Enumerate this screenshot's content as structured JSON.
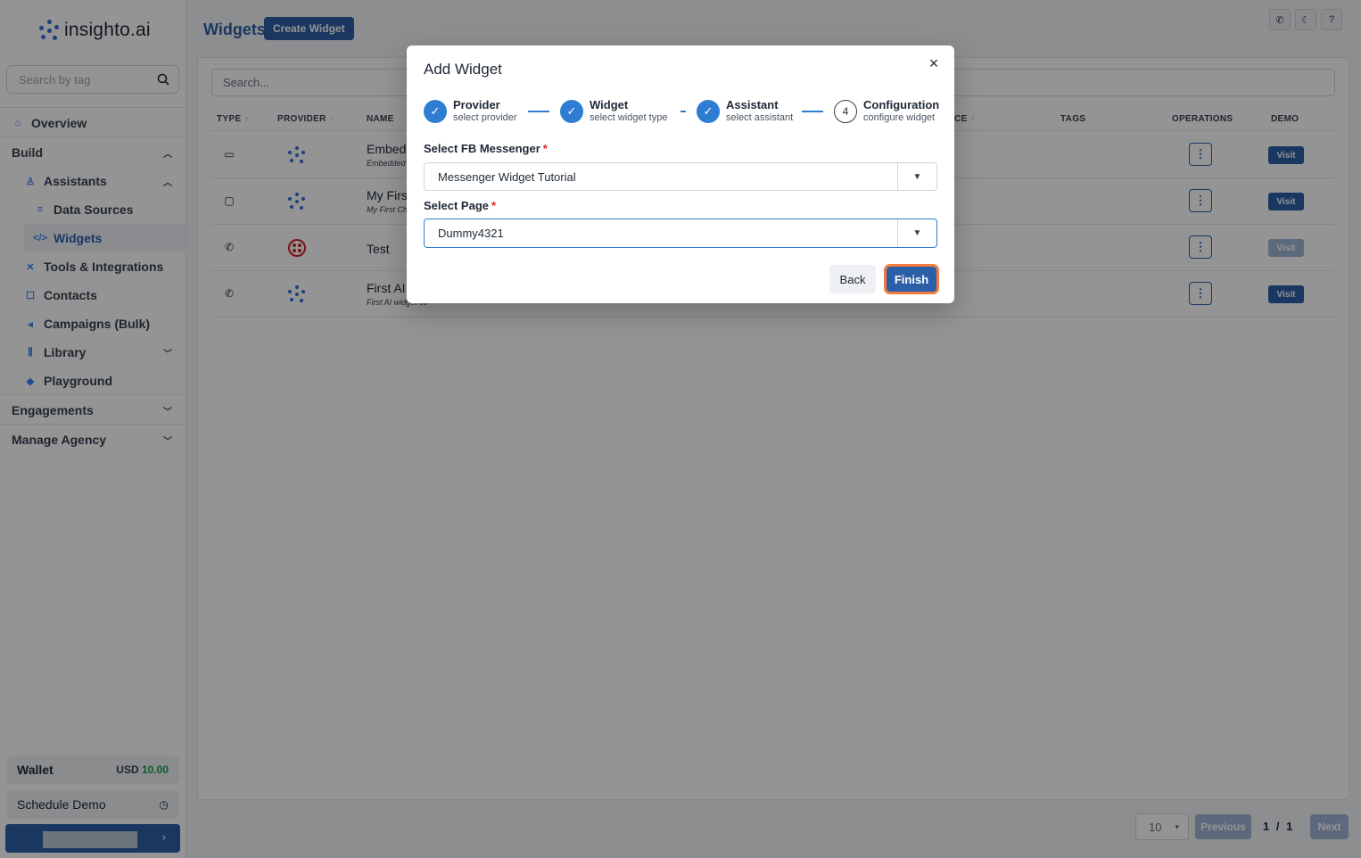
{
  "app": {
    "logo_text": "insighto.ai"
  },
  "sidebar": {
    "search_placeholder": "Search by tag",
    "items": [
      {
        "label": "Overview",
        "icon": "home-icon"
      },
      {
        "label": "Build",
        "icon": "",
        "chevron": "up"
      },
      {
        "label": "Assistants",
        "icon": "user-icon",
        "chevron": "up"
      },
      {
        "label": "Data Sources",
        "icon": "database-icon"
      },
      {
        "label": "Widgets",
        "icon": "code-icon"
      },
      {
        "label": "Tools & Integrations",
        "icon": "tools-icon"
      },
      {
        "label": "Contacts",
        "icon": "contacts-icon"
      },
      {
        "label": "Campaigns (Bulk)",
        "icon": "megaphone-icon"
      },
      {
        "label": "Library",
        "icon": "library-icon",
        "chevron": "down"
      },
      {
        "label": "Playground",
        "icon": "gamepad-icon"
      },
      {
        "label": "Engagements",
        "icon": "",
        "chevron": "down"
      },
      {
        "label": "Manage Agency",
        "icon": "",
        "chevron": "down"
      }
    ],
    "wallet": {
      "label": "Wallet",
      "currency": "USD",
      "amount": "10.00"
    },
    "schedule_demo": "Schedule Demo"
  },
  "header": {
    "title": "Widgets",
    "create_button": "Create Widget"
  },
  "main": {
    "search_placeholder": "Search...",
    "columns": [
      "TYPE",
      "PROVIDER",
      "NAME",
      "CE",
      "TAGS",
      "OPERATIONS",
      "DEMO"
    ],
    "rows": [
      {
        "type_icon": "window-icon",
        "provider": "insighto",
        "name": "Embed",
        "sub": "Embedded",
        "visit": "Visit",
        "visit_enabled": true
      },
      {
        "type_icon": "chat-icon",
        "provider": "insighto",
        "name": "My Firs",
        "sub": "My First Ch",
        "visit": "Visit",
        "visit_enabled": true
      },
      {
        "type_icon": "phone-icon",
        "provider": "twilio",
        "name": "Test",
        "sub": "",
        "visit": "Visit",
        "visit_enabled": false
      },
      {
        "type_icon": "phone-call-icon",
        "provider": "insighto",
        "name": "First AI",
        "sub": "First AI widget co",
        "visit": "Visit",
        "visit_enabled": true
      }
    ],
    "pagination": {
      "page_size": "10",
      "previous": "Previous",
      "current": "1",
      "separator": "/",
      "total": "1",
      "next": "Next"
    }
  },
  "modal": {
    "title": "Add Widget",
    "steps": [
      {
        "label": "Provider",
        "sub": "select provider",
        "state": "done"
      },
      {
        "label": "Widget",
        "sub": "select widget type",
        "state": "done"
      },
      {
        "label": "Assistant",
        "sub": "select assistant",
        "state": "done"
      },
      {
        "label": "Configuration",
        "sub": "configure widget",
        "state": "current",
        "number": "4"
      }
    ],
    "fb_label": "Select FB Messenger",
    "fb_value": "Messenger Widget Tutorial",
    "page_label": "Select Page",
    "page_value": "Dummy4321",
    "required_mark": "*",
    "back": "Back",
    "finish": "Finish"
  },
  "colors": {
    "primary": "#2b5fa8",
    "accent": "#2f7dd3",
    "focus_ring": "#f47a3d",
    "wallet_amount": "#16a34a"
  }
}
